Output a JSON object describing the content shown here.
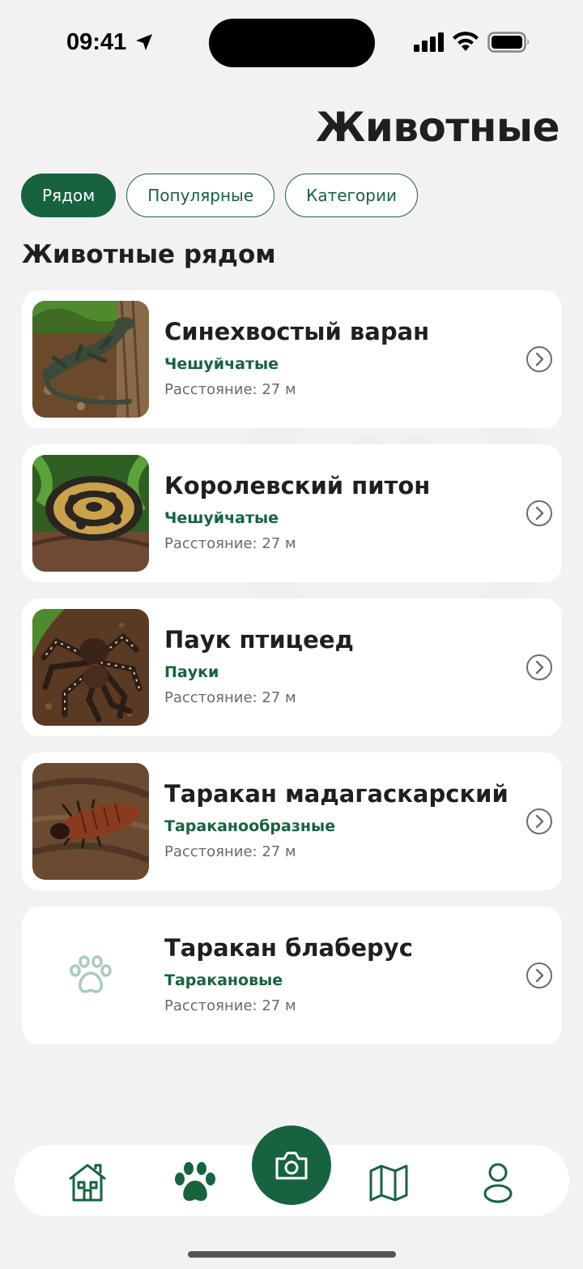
{
  "status_bar": {
    "time": "09:41"
  },
  "header": {
    "title": "Животные"
  },
  "filters": {
    "chips": [
      {
        "label": "Рядом",
        "active": true
      },
      {
        "label": "Популярные",
        "active": false
      },
      {
        "label": "Категории",
        "active": false
      }
    ]
  },
  "section": {
    "title": "Животные рядом"
  },
  "animals": [
    {
      "name": "Синехвостый варан",
      "category": "Чешуйчатые",
      "distance": "Расстояние: 27 м",
      "image": "monitor-lizard-photo"
    },
    {
      "name": "Королевский питон",
      "category": "Чешуйчатые",
      "distance": "Расстояние: 27 м",
      "image": "ball-python-photo"
    },
    {
      "name": "Паук птицеед",
      "category": "Пауки",
      "distance": "Расстояние: 27 м",
      "image": "tarantula-photo"
    },
    {
      "name": "Таракан мадагаскарский",
      "category": "Тараканообразные",
      "distance": "Расстояние: 27 м",
      "image": "cockroach-photo"
    },
    {
      "name": "Таракан блаберус",
      "category": "Таракановые",
      "distance": "Расстояние: 27 м",
      "image": "paw-placeholder-icon"
    }
  ],
  "tab_bar": {
    "items": [
      "home-icon",
      "paw-icon",
      "camera-icon",
      "map-icon",
      "profile-icon"
    ]
  },
  "colors": {
    "accent": "#17633f",
    "background": "#f2f2f2",
    "card": "#ffffff",
    "placeholder_icon": "#a9cbbd"
  }
}
